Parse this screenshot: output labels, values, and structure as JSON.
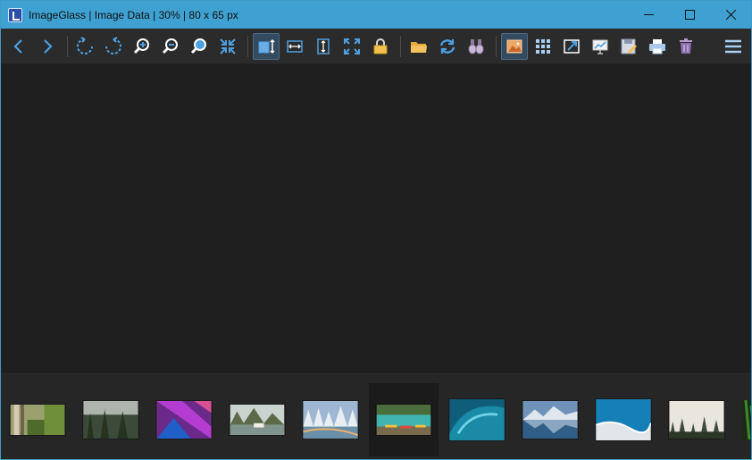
{
  "window": {
    "title": "ImageGlass  |  Image Data  |  30%  |  80 x 65 px",
    "accent": "#3fa1d1"
  },
  "titlebar": {
    "controls": [
      {
        "name": "minimize-icon"
      },
      {
        "name": "maximize-icon"
      },
      {
        "name": "close-icon"
      }
    ]
  },
  "toolbar": {
    "buttons": [
      {
        "icon": "arrow-left-icon",
        "label": "Previous image"
      },
      {
        "icon": "arrow-right-icon",
        "label": "Next image"
      },
      {
        "icon": "rotate-left-icon",
        "label": "Rotate left"
      },
      {
        "icon": "rotate-right-icon",
        "label": "Rotate right"
      },
      {
        "icon": "zoom-in-icon",
        "label": "Zoom in"
      },
      {
        "icon": "zoom-out-icon",
        "label": "Zoom out"
      },
      {
        "icon": "actual-size-icon",
        "label": "Actual size"
      },
      {
        "icon": "scale-to-fit-icon",
        "label": "Scale to fit"
      },
      {
        "icon": "auto-zoom-icon",
        "label": "Auto zoom",
        "active": true
      },
      {
        "icon": "scale-to-width-icon",
        "label": "Scale to width"
      },
      {
        "icon": "scale-to-height-icon",
        "label": "Scale to height"
      },
      {
        "icon": "scale-to-fill-icon",
        "label": "Scale to fill"
      },
      {
        "icon": "lock-zoom-icon",
        "label": "Lock zoom ratio"
      },
      {
        "icon": "open-folder-icon",
        "label": "Open file"
      },
      {
        "icon": "refresh-icon",
        "label": "Refresh"
      },
      {
        "icon": "go-to-image-icon",
        "label": "Go to image"
      },
      {
        "icon": "thumbnail-bar-icon",
        "label": "Thumbnail bar",
        "active": true
      },
      {
        "icon": "checkerboard-icon",
        "label": "Checkerboard background"
      },
      {
        "icon": "fullscreen-icon",
        "label": "Full screen"
      },
      {
        "icon": "slideshow-icon",
        "label": "Slideshow"
      },
      {
        "icon": "save-as-icon",
        "label": "Save as"
      },
      {
        "icon": "print-icon",
        "label": "Print"
      },
      {
        "icon": "delete-icon",
        "label": "Delete"
      },
      {
        "icon": "main-menu-icon",
        "label": "Menu"
      }
    ]
  },
  "thumbnails": [
    {
      "subject": "birch trees with moss",
      "selected": false
    },
    {
      "subject": "misty pine forest",
      "selected": false
    },
    {
      "subject": "purple geometric building",
      "selected": false
    },
    {
      "subject": "boat on bay with limestone cliffs",
      "selected": false
    },
    {
      "subject": "snowy forest with river",
      "selected": false
    },
    {
      "subject": "kayaks on turquoise lake",
      "selected": true
    },
    {
      "subject": "ocean wave",
      "selected": false
    },
    {
      "subject": "mountain lake reflection",
      "selected": false
    },
    {
      "subject": "aerial beach shoreline",
      "selected": false
    },
    {
      "subject": "foggy forest",
      "selected": false
    },
    {
      "subject": "green fern",
      "selected": false
    }
  ]
}
